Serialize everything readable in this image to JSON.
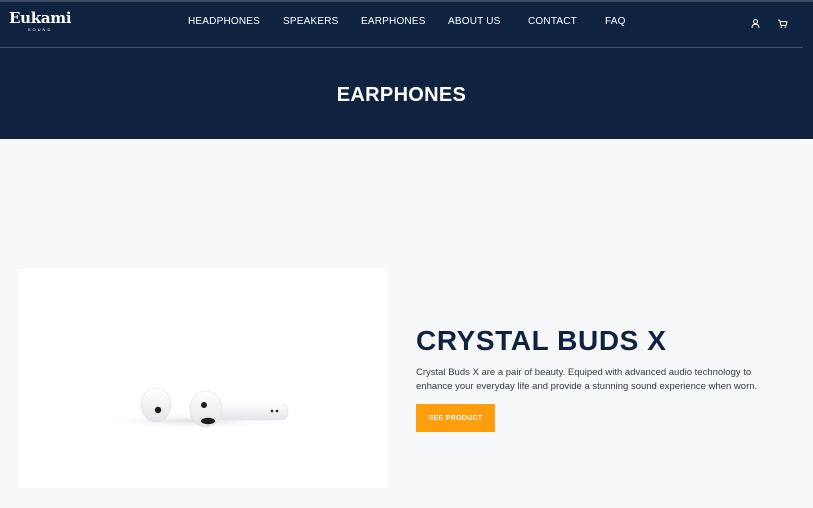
{
  "brand": {
    "name": "Eukami",
    "tagline": "SOUND"
  },
  "nav": {
    "items": [
      "HEADPHONES",
      "SPEAKERS",
      "EARPHONES",
      "ABOUT US",
      "CONTACT",
      "FAQ"
    ],
    "icons": [
      "user-icon",
      "cart-icon"
    ]
  },
  "hero": {
    "title": "EARPHONES"
  },
  "product": {
    "name": "CRYSTAL BUDS X",
    "description": "Crystal Buds X are a pair of beauty. Equiped with advanced audio technology to enhance your everyday life and provide a stunning sound experience when worn.",
    "cta_label": "SEE PRODUCT"
  },
  "colors": {
    "navy": "#0f2340",
    "accent": "#ff9e0d",
    "background": "#f7f8fa"
  }
}
